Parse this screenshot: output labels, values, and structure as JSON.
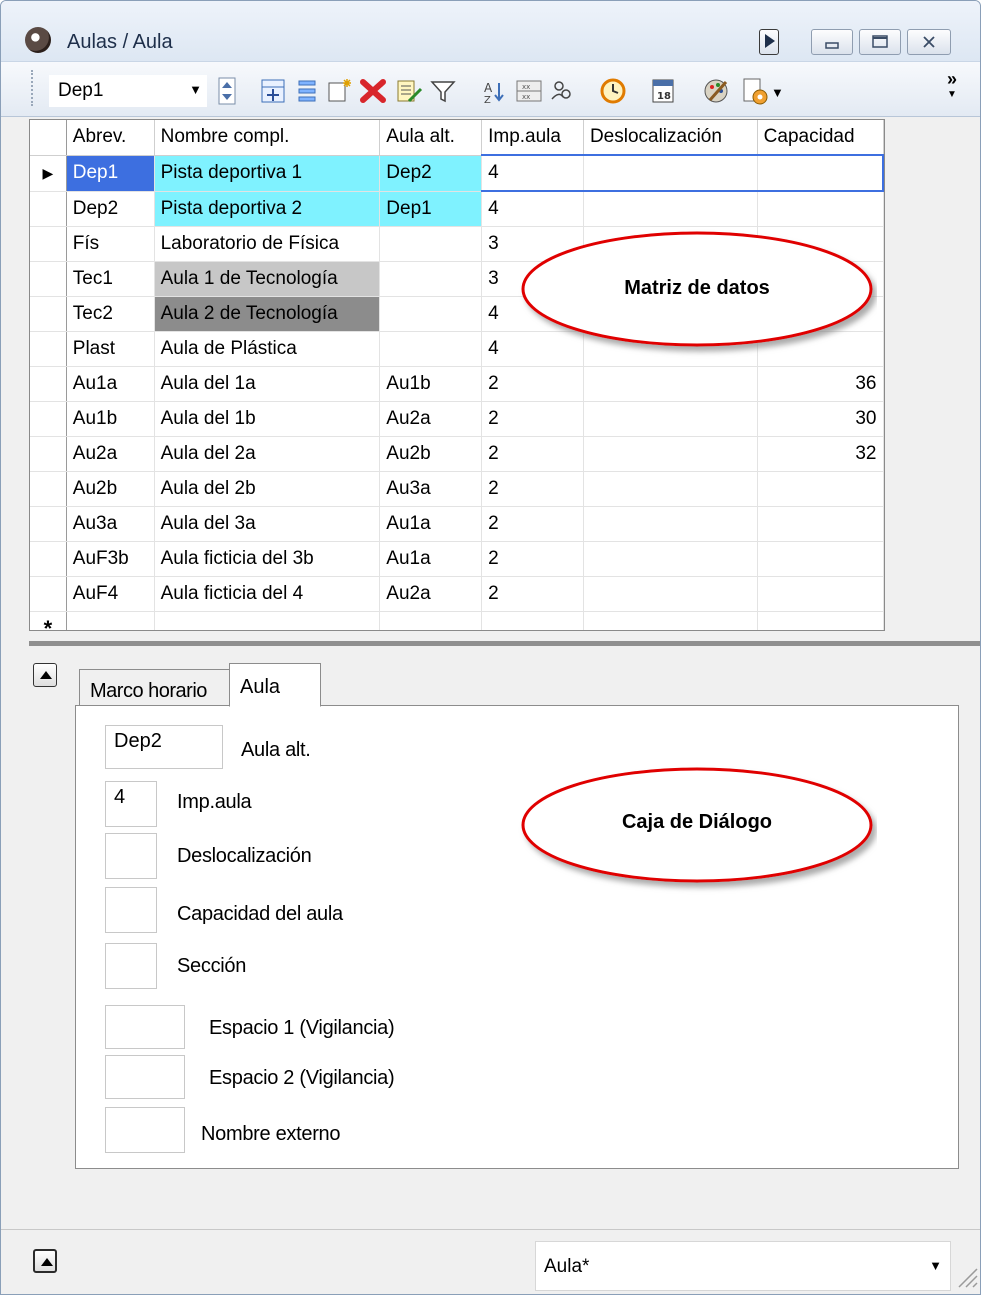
{
  "window": {
    "title": "Aulas / Aula"
  },
  "toolbar": {
    "selector_value": "Dep1",
    "overflow": "»"
  },
  "grid": {
    "columns": [
      "Abrev.",
      "Nombre compl.",
      "Aula alt.",
      "Imp.aula",
      "Deslocalización",
      "Capacidad"
    ],
    "rows": [
      {
        "abrev": "Dep1",
        "nombre": "Pista deportiva 1",
        "alt": "Dep2",
        "imp": "4",
        "desloc": "",
        "cap": ""
      },
      {
        "abrev": "Dep2",
        "nombre": "Pista deportiva 2",
        "alt": "Dep1",
        "imp": "4",
        "desloc": "",
        "cap": ""
      },
      {
        "abrev": "Fís",
        "nombre": "Laboratorio de Física",
        "alt": "",
        "imp": "3",
        "desloc": "",
        "cap": ""
      },
      {
        "abrev": "Tec1",
        "nombre": "Aula 1 de Tecnología",
        "alt": "",
        "imp": "3",
        "desloc": "",
        "cap": ""
      },
      {
        "abrev": "Tec2",
        "nombre": "Aula 2 de Tecnología",
        "alt": "",
        "imp": "4",
        "desloc": "",
        "cap": ""
      },
      {
        "abrev": "Plast",
        "nombre": "Aula de Plástica",
        "alt": "",
        "imp": "4",
        "desloc": "",
        "cap": ""
      },
      {
        "abrev": "Au1a",
        "nombre": "Aula del 1a",
        "alt": "Au1b",
        "imp": "2",
        "desloc": "",
        "cap": "36"
      },
      {
        "abrev": "Au1b",
        "nombre": "Aula del 1b",
        "alt": "Au2a",
        "imp": "2",
        "desloc": "",
        "cap": "30"
      },
      {
        "abrev": "Au2a",
        "nombre": "Aula del 2a",
        "alt": "Au2b",
        "imp": "2",
        "desloc": "",
        "cap": "32"
      },
      {
        "abrev": "Au2b",
        "nombre": "Aula del 2b",
        "alt": "Au3a",
        "imp": "2",
        "desloc": "",
        "cap": ""
      },
      {
        "abrev": "Au3a",
        "nombre": "Aula del 3a",
        "alt": "Au1a",
        "imp": "2",
        "desloc": "",
        "cap": ""
      },
      {
        "abrev": "AuF3b",
        "nombre": "Aula ficticia del 3b",
        "alt": "Au1a",
        "imp": "2",
        "desloc": "",
        "cap": ""
      },
      {
        "abrev": "AuF4",
        "nombre": "Aula ficticia del 4",
        "alt": "Au2a",
        "imp": "2",
        "desloc": "",
        "cap": ""
      }
    ],
    "current_row_marker": "▶",
    "new_row_marker": "*",
    "colors": {
      "selected": "#3d6fe0",
      "cyan": "#7ff2ff",
      "lightgray": "#c7c7c7",
      "darkgray": "#8c8c8c"
    }
  },
  "callouts": {
    "grid_label": "Matriz de datos",
    "dialog_label": "Caja de Diálogo"
  },
  "tabs": [
    {
      "label": "Marco horario"
    },
    {
      "label": "Aula"
    }
  ],
  "form": {
    "aula_alt": {
      "value": "Dep2",
      "label": "Aula alt."
    },
    "imp_aula": {
      "value": "4",
      "label": "Imp.aula"
    },
    "deslocalizacion": {
      "value": "",
      "label": "Deslocalización"
    },
    "capacidad": {
      "value": "",
      "label": "Capacidad del aula"
    },
    "seccion": {
      "value": "",
      "label": "Sección"
    },
    "espacio1": {
      "value": "",
      "label": "Espacio 1 (Vigilancia)"
    },
    "espacio2": {
      "value": "",
      "label": "Espacio 2 (Vigilancia)"
    },
    "nombre_externo": {
      "value": "",
      "label": "Nombre externo"
    }
  },
  "status": {
    "form_selector": "Aula*"
  }
}
